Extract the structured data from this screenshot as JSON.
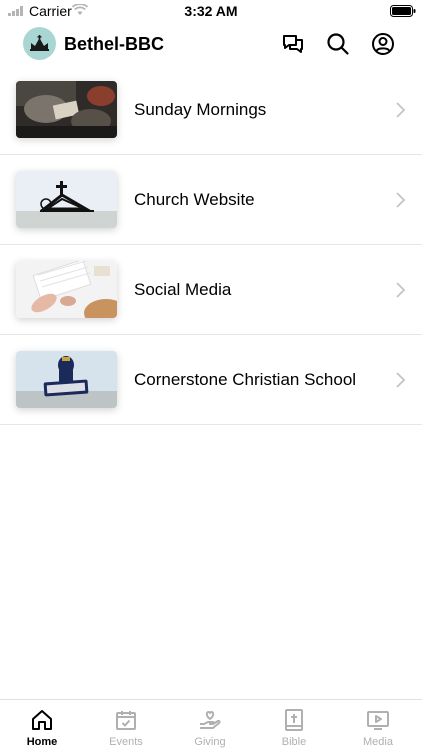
{
  "status_bar": {
    "carrier": "Carrier",
    "time": "3:32 AM"
  },
  "header": {
    "title": "Bethel-BBC"
  },
  "list": [
    {
      "label": "Sunday Mornings",
      "thumb": "worship-photo"
    },
    {
      "label": "Church Website",
      "thumb": "church-logo"
    },
    {
      "label": "Social Media",
      "thumb": "keyboard-photo"
    },
    {
      "label": "Cornerstone Christian School",
      "thumb": "chargers-logo"
    }
  ],
  "tabs": [
    {
      "label": "Home",
      "icon": "home-icon",
      "active": true
    },
    {
      "label": "Events",
      "icon": "calendar-icon",
      "active": false
    },
    {
      "label": "Giving",
      "icon": "giving-icon",
      "active": false
    },
    {
      "label": "Bible",
      "icon": "bible-icon",
      "active": false
    },
    {
      "label": "Media",
      "icon": "media-icon",
      "active": false
    }
  ],
  "colors": {
    "accent": "#000000",
    "inactive": "#b0b0b0",
    "logo_bg": "#a9d6d3"
  }
}
